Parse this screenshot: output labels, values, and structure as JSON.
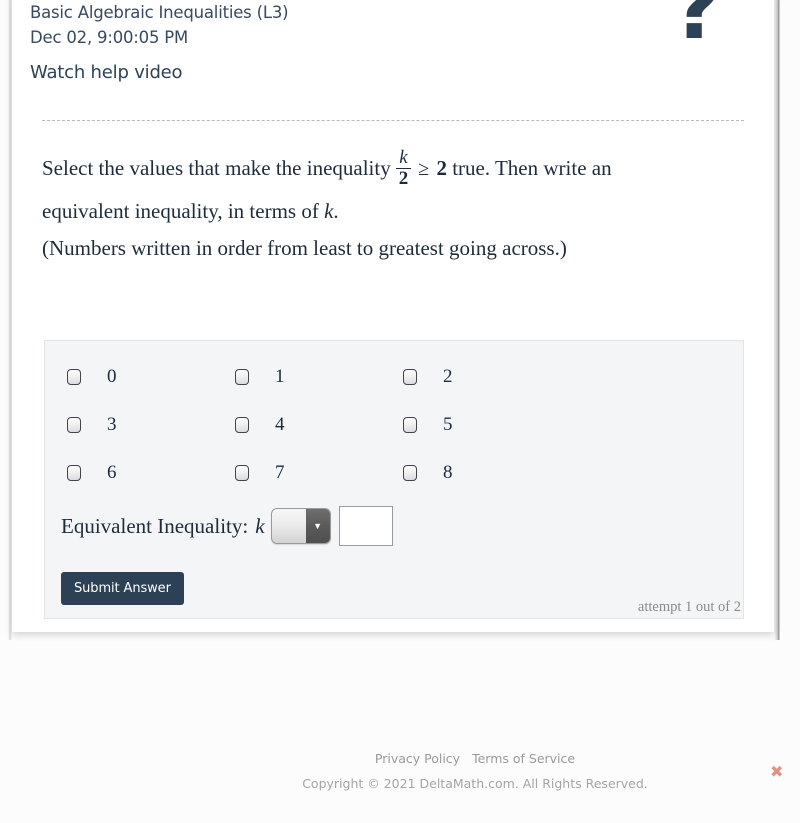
{
  "header": {
    "assignment_title": "Basic Algebraic Inequalities (L3)",
    "timestamp": "Dec 02, 9:00:05 PM",
    "help_video_label": "Watch help video",
    "help_icon": "question-mark-icon"
  },
  "question": {
    "text_part1": "Select the values that make the inequality",
    "fraction_numerator": "k",
    "fraction_denominator": "2",
    "operator": "≥",
    "operand": "2",
    "text_part2": "true. Then write an",
    "text_line2_a": "equivalent inequality, in terms of",
    "text_line2_var": "k",
    "text_line2_b": ".",
    "note": "(Numbers written in order from least to greatest going across.)"
  },
  "answer_panel": {
    "checkbox_rows": [
      [
        {
          "label": "0",
          "checked": false
        },
        {
          "label": "1",
          "checked": false
        },
        {
          "label": "2",
          "checked": false
        }
      ],
      [
        {
          "label": "3",
          "checked": false
        },
        {
          "label": "4",
          "checked": false
        },
        {
          "label": "5",
          "checked": false
        }
      ],
      [
        {
          "label": "6",
          "checked": false
        },
        {
          "label": "7",
          "checked": false
        },
        {
          "label": "8",
          "checked": false
        }
      ]
    ],
    "equivalent_inequality": {
      "label": "Equivalent Inequality:",
      "variable": "k",
      "operator_select_value": "",
      "operator_arrow_icon": "▼",
      "value_input_value": "",
      "value_input_placeholder": ""
    },
    "submit_label": "Submit Answer",
    "attempt_text": "attempt 1 out of 2"
  },
  "footer": {
    "privacy_label": "Privacy Policy",
    "terms_label": "Terms of Service",
    "copyright": "Copyright © 2021 DeltaMath.com. All Rights Reserved.",
    "close_icon": "✖"
  },
  "colors": {
    "brand_navy": "#2d4156",
    "panel_bg": "#f4f5f7",
    "close_icon": "#e09382",
    "text": "#1d2b3a"
  }
}
